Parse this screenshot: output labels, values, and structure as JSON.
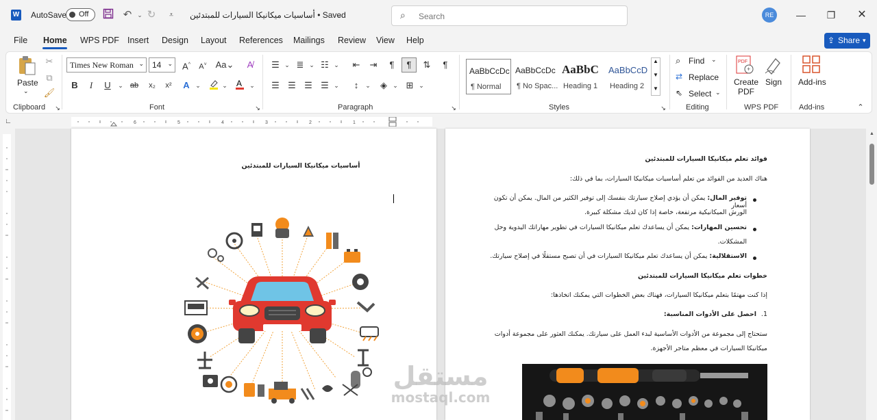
{
  "titlebar": {
    "autosave_label": "AutoSave",
    "autosave_state": "Off",
    "doc_title": "أساسيات ميكانيكا السيارات للمبتدئين • Saved",
    "search_placeholder": "Search",
    "user_initials": "RE"
  },
  "menu": {
    "tabs": [
      "File",
      "Home",
      "WPS PDF",
      "Insert",
      "Design",
      "Layout",
      "References",
      "Mailings",
      "Review",
      "View",
      "Help"
    ],
    "active_tab": "Home",
    "share_label": "Share"
  },
  "ribbon": {
    "clipboard": {
      "paste_label": "Paste",
      "group_label": "Clipboard"
    },
    "font": {
      "font_name": "Times New Roman",
      "font_size": "14",
      "group_label": "Font"
    },
    "paragraph": {
      "group_label": "Paragraph"
    },
    "styles": {
      "group_label": "Styles",
      "items": [
        {
          "preview": "AaBbCcDc",
          "name": "¶ Normal"
        },
        {
          "preview": "AaBbCcDc",
          "name": "¶ No Spac..."
        },
        {
          "preview": "AaBbC",
          "name": "Heading 1"
        },
        {
          "preview": "AaBbCcD",
          "name": "Heading 2"
        }
      ]
    },
    "editing": {
      "find_label": "Find",
      "replace_label": "Replace",
      "select_label": "Select",
      "group_label": "Editing"
    },
    "wps_pdf": {
      "create_label": "Create PDF",
      "sign_label": "Sign",
      "group_label": "WPS PDF"
    },
    "addins": {
      "button_label": "Add-ins",
      "group_label": "Add-ins"
    }
  },
  "left_page": {
    "title": "أساسيات ميكانيكا السيارات للمبتدئين"
  },
  "right_page": {
    "heading1": "فوائد تعلم ميكانيكا السيارات للمبتدئين",
    "intro": "هناك العديد من الفوائد من تعلم أساسيات ميكانيكا السيارات، بما في ذلك:",
    "bullets": [
      {
        "bold": "توفير المال:",
        "line1": " يمكن أن يؤدي إصلاح سيارتك بنفسك إلى توفير الكثير من المال. يمكن أن تكون أسعار",
        "line2": "الورش الميكانيكية مرتفعة، خاصة إذا كان لديك مشكلة كبيرة."
      },
      {
        "bold": "تحسين المهارات:",
        "line1": " يمكن أن يساعدك تعلم ميكانيكا السيارات في تطوير مهاراتك اليدوية وحل",
        "line2": "المشكلات."
      },
      {
        "bold": "الاستقلالية:",
        "line1": " يمكن أن يساعدك تعلم ميكانيكا السيارات في أن تصبح مستقلًا في إصلاح سيارتك.",
        "line2": ""
      }
    ],
    "heading2": "خطوات تعلم ميكانيكا السيارات للمبتدئين",
    "intro2": "إذا كنت مهتمًا بتعلم ميكانيكا السيارات، فهناك بعض الخطوات التي يمكنك اتخاذها:",
    "step1": "احصل على الأدوات المناسبة:",
    "step1_num": "1.",
    "para_line1": "ستحتاج إلى مجموعة من الأدوات الأساسية لبدء العمل على سيارتك. يمكنك العثور على مجموعة أدوات",
    "para_line2": "ميكانيكا السيارات في معظم متاجر الأجهزة."
  },
  "watermark": {
    "line1": "مستقل",
    "line2": "mostaql.com"
  },
  "colors": {
    "accent": "#185abd",
    "car_red": "#e0392f",
    "tool_orange": "#f28b1c"
  }
}
